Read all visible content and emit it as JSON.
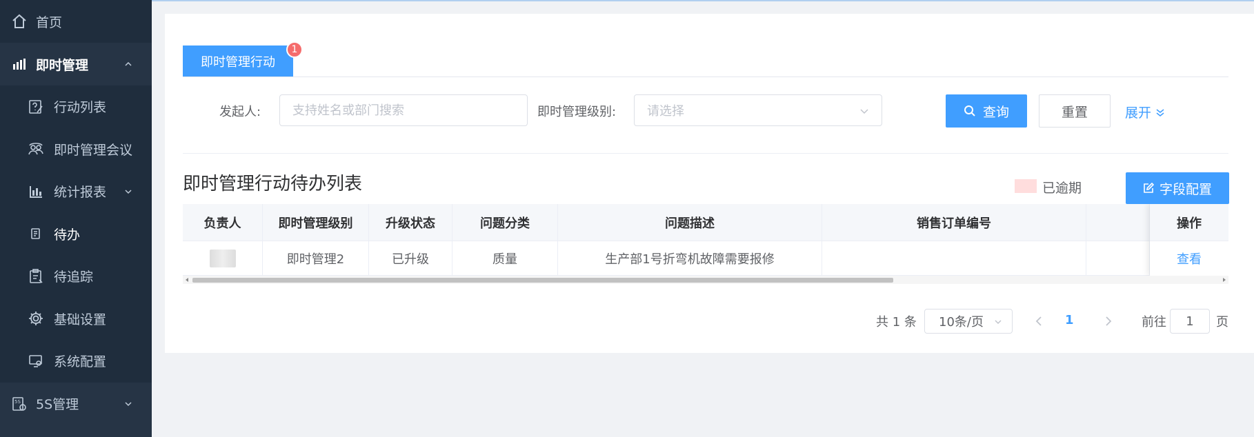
{
  "sidebar": {
    "home": "首页",
    "group": "即时管理",
    "items": [
      {
        "label": "行动列表"
      },
      {
        "label": "即时管理会议"
      },
      {
        "label": "统计报表"
      },
      {
        "label": "待办"
      },
      {
        "label": "待追踪"
      },
      {
        "label": "基础设置"
      },
      {
        "label": "系统配置"
      }
    ],
    "s5": "5S管理"
  },
  "tabs": [
    {
      "label": "即时管理行动",
      "badge": "1"
    }
  ],
  "filter": {
    "initiator_label": "发起人:",
    "initiator_placeholder": "支持姓名或部门搜索",
    "level_label": "即时管理级别:",
    "level_placeholder": "请选择",
    "query": "查询",
    "reset": "重置",
    "expand": "展开"
  },
  "list": {
    "title": "即时管理行动待办列表",
    "legend_overdue": "已逾期",
    "field_config": "字段配置",
    "overdue_color": "#ffdddd"
  },
  "table": {
    "columns": [
      "负责人",
      "即时管理级别",
      "升级状态",
      "问题分类",
      "问题描述",
      "销售订单编号",
      "",
      "操作"
    ],
    "rows": [
      {
        "owner": "",
        "level": "即时管理2",
        "status": "已升级",
        "category": "质量",
        "desc": "生产部1号折弯机故障需要报修",
        "order": "",
        "extra": "",
        "action": "查看"
      }
    ]
  },
  "pager": {
    "total": "共 1 条",
    "size": "10条/页",
    "current": "1",
    "goto": "前往",
    "goto_value": "1",
    "page_suffix": "页"
  },
  "colors": {
    "primary": "#409eff",
    "sidebar": "#263445",
    "badge": "#f56c6c"
  }
}
